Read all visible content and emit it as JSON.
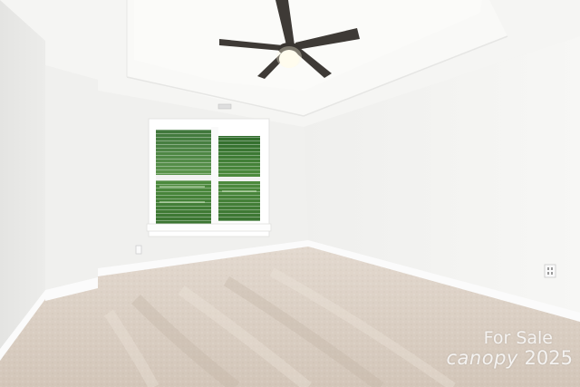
{
  "watermark": {
    "line1": "For Sale",
    "brand": "canopy",
    "year": "2025"
  },
  "colors": {
    "wall_left": "#ececea",
    "wall_back": "#f1f1ef",
    "wall_right": "#f4f4f2",
    "ceiling": "#f6f6f4",
    "carpet": "#d9cdc2",
    "trim": "#ffffff",
    "fan_dark": "#3b3835",
    "foliage": "#3f7a36"
  }
}
